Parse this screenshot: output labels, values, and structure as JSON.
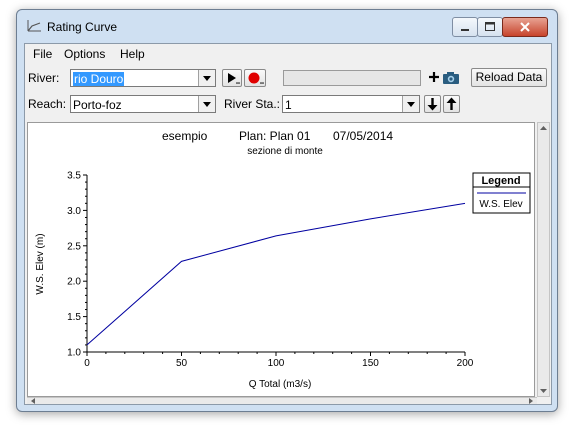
{
  "window": {
    "title": "Rating Curve"
  },
  "menu": {
    "file": "File",
    "options": "Options",
    "help": "Help"
  },
  "toolbar": {
    "river_label": "River:",
    "river_value": "rio Douro",
    "reach_label": "Reach:",
    "reach_value": "Porto-foz",
    "river_sta_label": "River Sta.:",
    "river_sta_value": "1",
    "reload_label": "Reload Data"
  },
  "chart_data": {
    "type": "line",
    "title_left": "esempio",
    "title_plan": "Plan: Plan 01",
    "title_date": "07/05/2014",
    "subtitle": "sezione di monte",
    "xlabel": "Q Total  (m3/s)",
    "ylabel": "W.S. Elev  (m)",
    "xlim": [
      0,
      200
    ],
    "ylim": [
      1.0,
      3.5
    ],
    "xticks": [
      "0",
      "50",
      "100",
      "150",
      "200"
    ],
    "yticks": [
      "1.0",
      "1.5",
      "2.0",
      "2.5",
      "3.0",
      "3.5"
    ],
    "legend_title": "Legend",
    "legend_placement": "top-right",
    "grid": false,
    "series": [
      {
        "name": "W.S. Elev",
        "color": "#0000a0",
        "x": [
          0,
          50,
          100,
          150,
          200
        ],
        "y": [
          1.1,
          2.28,
          2.64,
          2.88,
          3.1
        ]
      }
    ]
  }
}
